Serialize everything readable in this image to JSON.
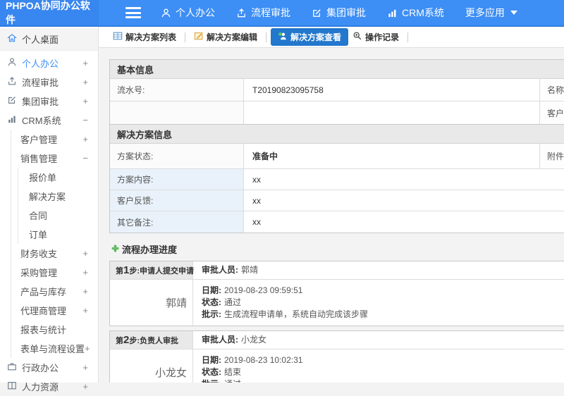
{
  "colors": {
    "accent_blue": "#3d8ef5",
    "active_tab_blue": "#2377cd",
    "label_cell_blue": "#e9f2fb",
    "plus_green": "#55b555"
  },
  "header": {
    "logo_text": "PHPOA协同办公软件",
    "nav_items": [
      {
        "label": "个人办公",
        "icon": "user-icon"
      },
      {
        "label": "流程审批",
        "icon": "workflow-icon"
      },
      {
        "label": "集团审批",
        "icon": "edit-square-icon"
      },
      {
        "label": "CRM系统",
        "icon": "bar-chart-icon"
      },
      {
        "label": "更多应用",
        "icon": "caret-down-icon"
      }
    ]
  },
  "sidebar": {
    "items": [
      {
        "label": "个人桌面"
      },
      {
        "label": "个人办公",
        "expander": "+"
      },
      {
        "label": "流程审批",
        "expander": "+"
      },
      {
        "label": "集团审批",
        "expander": "+"
      },
      {
        "label": "CRM系统",
        "expander": "−"
      },
      {
        "label": "客户管理",
        "expander": "+"
      },
      {
        "label": "销售管理",
        "expander": "−"
      },
      {
        "label": "报价单"
      },
      {
        "label": "解决方案"
      },
      {
        "label": "合同"
      },
      {
        "label": "订单"
      },
      {
        "label": "财务收支",
        "expander": "+"
      },
      {
        "label": "采购管理",
        "expander": "+"
      },
      {
        "label": "产品与库存",
        "expander": "+"
      },
      {
        "label": "代理商管理",
        "expander": "+"
      },
      {
        "label": "报表与统计"
      },
      {
        "label": "表单与流程设置",
        "expander": "+"
      },
      {
        "label": "行政办公",
        "expander": "+"
      },
      {
        "label": "人力资源",
        "expander": "+"
      }
    ]
  },
  "tabs": [
    {
      "label": "解决方案列表"
    },
    {
      "label": "解决方案编辑"
    },
    {
      "label": "解决方案查看"
    },
    {
      "label": "操作记录"
    }
  ],
  "basic_info": {
    "title": "基本信息",
    "rows": [
      {
        "label": "流水号:",
        "value": "T20190823095758",
        "label2": "名称"
      },
      {
        "label": "",
        "value": "",
        "label2": "客户"
      }
    ]
  },
  "solution_info": {
    "title": "解决方案信息",
    "status_label": "方案状态:",
    "status_value": "准备中",
    "status_label2": "附件",
    "rows": [
      {
        "label": "方案内容:",
        "value": "xx"
      },
      {
        "label": "客户反馈:",
        "value": "xx"
      },
      {
        "label": "其它备注:",
        "value": "xx"
      }
    ]
  },
  "progress": {
    "title": "流程办理进度",
    "approver_label": "审批人员:",
    "date_label": "日期:",
    "status_label": "状态:",
    "comment_label": "批示:",
    "steps": [
      {
        "step_prefix": "第",
        "step_num": "1",
        "step_suffix": "步:申请人提交申请",
        "approver": "郭靖",
        "name": "郭靖",
        "date": "2019-08-23 09:59:51",
        "status": "通过",
        "comment": "生成流程申请单，系统自动完成该步骤"
      },
      {
        "step_prefix": "第",
        "step_num": "2",
        "step_suffix": "步:负责人审批",
        "approver": "小龙女",
        "name": "小龙女",
        "date": "2019-08-23 10:02:31",
        "status": "结束",
        "comment": "通过"
      }
    ]
  }
}
